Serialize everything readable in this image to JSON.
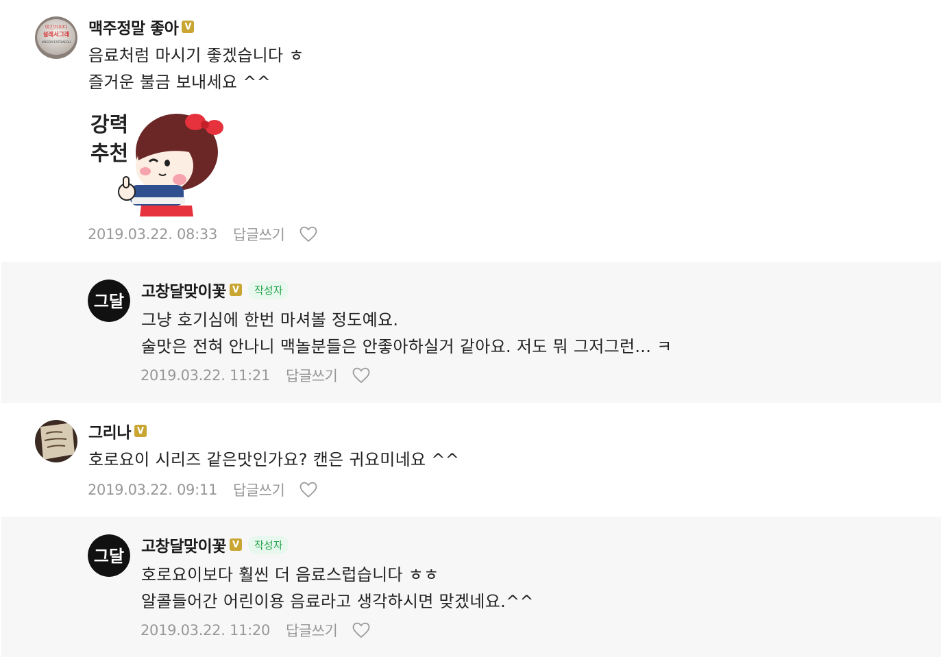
{
  "comments": [
    {
      "author": "맥주정말 좋아",
      "verified": "V",
      "lines": [
        "음료처럼 마시기 좋겠습니다 ㅎ",
        "즐거운 불금 보내세요 ^^"
      ],
      "sticker_text": [
        "강력",
        "추천"
      ],
      "date": "2019.03.22. 08:33",
      "reply_label": "답글쓰기",
      "avatar_text": [
        "여긴거이다",
        "설레서그래",
        "#BEERFESTDAEGU"
      ]
    },
    {
      "author": "고창달맞이꽃",
      "verified": "V",
      "tag": "작성자",
      "lines": [
        "그냥 호기심에 한번 마셔볼 정도예요.",
        "술맛은 전혀 안나니 맥놀분들은 안좋아하실거 같아요. 저도 뭐 그저그런... ㅋ"
      ],
      "date": "2019.03.22. 11:21",
      "reply_label": "답글쓰기",
      "avatar_text": "그달"
    },
    {
      "author": "그리나",
      "verified": "V",
      "lines": [
        "호로요이 시리즈 같은맛인가요? 캔은 귀요미네요 ^^"
      ],
      "date": "2019.03.22. 09:11",
      "reply_label": "답글쓰기"
    },
    {
      "author": "고창달맞이꽃",
      "verified": "V",
      "tag": "작성자",
      "lines": [
        "호로요이보다 훨씬 더 음료스럽습니다 ㅎㅎ",
        "알콜들어간 어린이용 음료라고 생각하시면 맞겠네요.^^"
      ],
      "date": "2019.03.22. 11:20",
      "reply_label": "답글쓰기",
      "avatar_text": "그달"
    }
  ],
  "colors": {
    "reply_bg": "#f7f7f7",
    "meta": "#979797",
    "badge": "#c9a531",
    "tag_text": "#1fa148",
    "tag_bg": "#e9f8ee"
  }
}
